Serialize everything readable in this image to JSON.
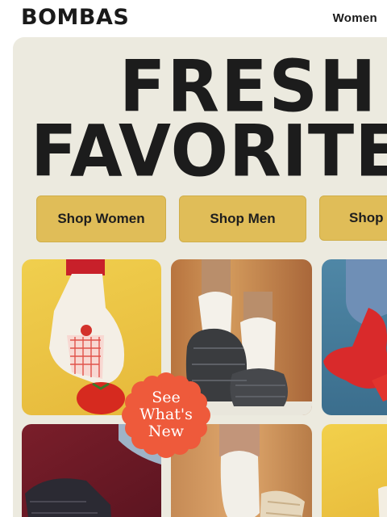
{
  "header": {
    "logo": "BOMBAS",
    "nav_women": "Women"
  },
  "hero": {
    "headline_line1": "FRESH",
    "headline_line2": "FAVORITES",
    "buttons": [
      {
        "label": "Shop Women"
      },
      {
        "label": "Shop Men"
      },
      {
        "label": "Shop"
      }
    ],
    "badge": {
      "line1": "See",
      "line2": "What's",
      "line3": "New",
      "color": "#ee5a3b"
    }
  },
  "colors": {
    "hero_bg": "#eceadf",
    "button": "#e0bd58",
    "text": "#1c1c1c"
  }
}
